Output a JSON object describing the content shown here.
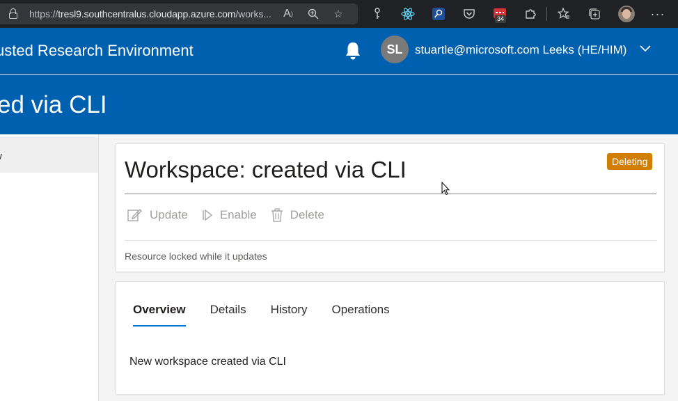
{
  "browser": {
    "url_prefix": "https://",
    "url_host": "tresl9.southcentralus.cloudapp.azure.com",
    "url_path": "/works...",
    "badge_count": "34",
    "icons": [
      "lock-icon",
      "read-aloud-icon",
      "zoom-icon",
      "favorite-add-icon",
      "key-icon",
      "react-icon",
      "search-ext-icon",
      "pocket-icon",
      "calendar-ext-icon",
      "extensions-icon",
      "favorites-icon",
      "collections-icon",
      "profile-avatar",
      "more-icon"
    ]
  },
  "header": {
    "app_title": "usted Research Environment",
    "avatar_initials": "SL",
    "user_name": "stuartle@microsoft.com Leeks (HE/HIM)"
  },
  "hero": {
    "title": "ed via CLI"
  },
  "sidebar": {
    "items": [
      {
        "label": "w"
      }
    ]
  },
  "workspace": {
    "title": "Workspace: created via CLI",
    "status": "Deleting",
    "status_color": "#d17f04",
    "commands": [
      {
        "label": "Update",
        "icon": "edit-icon"
      },
      {
        "label": "Enable",
        "icon": "play-icon"
      },
      {
        "label": "Delete",
        "icon": "trash-icon"
      }
    ],
    "lock_message": "Resource locked while it updates"
  },
  "details": {
    "tabs": [
      {
        "label": "Overview",
        "active": true
      },
      {
        "label": "Details",
        "active": false
      },
      {
        "label": "History",
        "active": false
      },
      {
        "label": "Operations",
        "active": false
      }
    ],
    "description": "New workspace created via CLI"
  },
  "colors": {
    "brand": "#0060b0",
    "tab_accent": "#0078d4"
  }
}
